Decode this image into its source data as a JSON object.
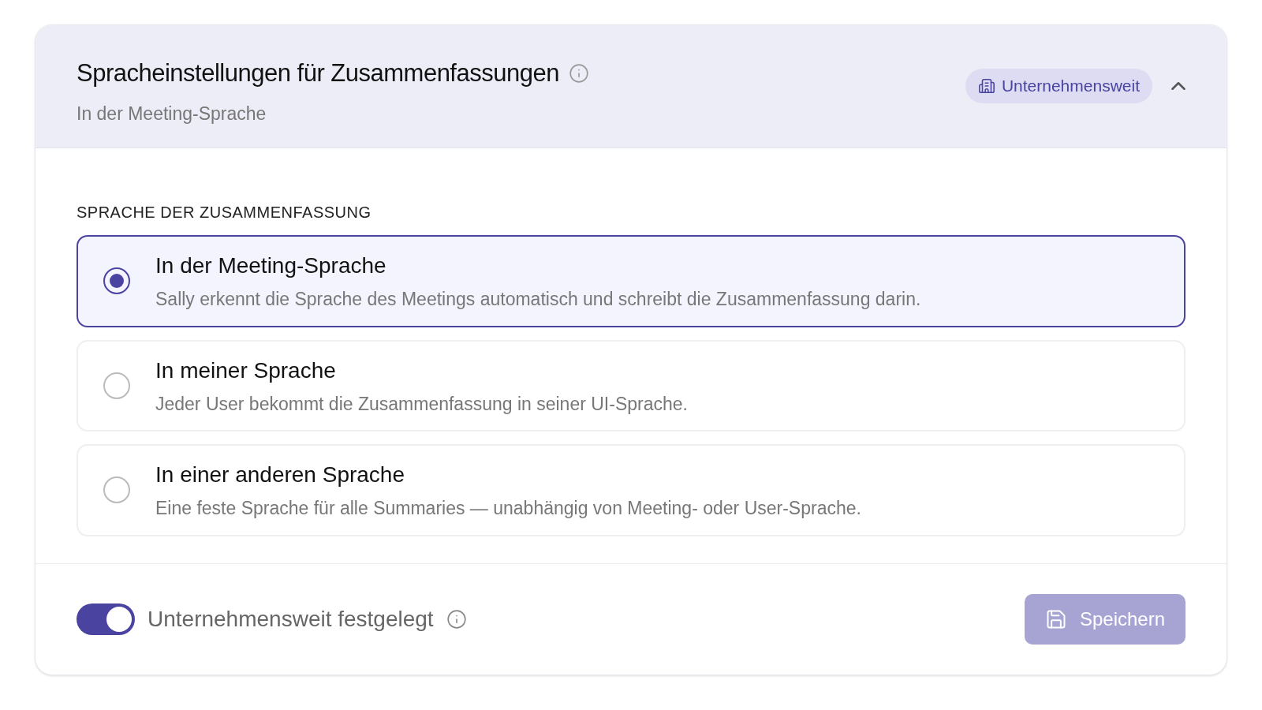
{
  "header": {
    "title": "Spracheinstellungen für Zusammenfassungen",
    "subtitle": "In der Meeting-Sprache",
    "scope_badge": "Unternehmensweit",
    "expanded": true
  },
  "section_label": "SPRACHE DER ZUSAMMENFASSUNG",
  "options": [
    {
      "title": "In der Meeting-Sprache",
      "description": "Sally erkennt die Sprache des Meetings automatisch und schreibt die Zusammenfassung darin.",
      "selected": true
    },
    {
      "title": "In meiner Sprache",
      "description": "Jeder User bekommt die Zusammenfassung in seiner UI-Sprache.",
      "selected": false
    },
    {
      "title": "In einer anderen Sprache",
      "description": "Eine feste Sprache für alle Summaries — unabhängig von Meeting- oder User-Sprache.",
      "selected": false
    }
  ],
  "footer": {
    "toggle": {
      "label": "Unternehmensweit festgelegt",
      "on": true
    },
    "save_button": {
      "label": "Speichern",
      "disabled": true
    }
  }
}
